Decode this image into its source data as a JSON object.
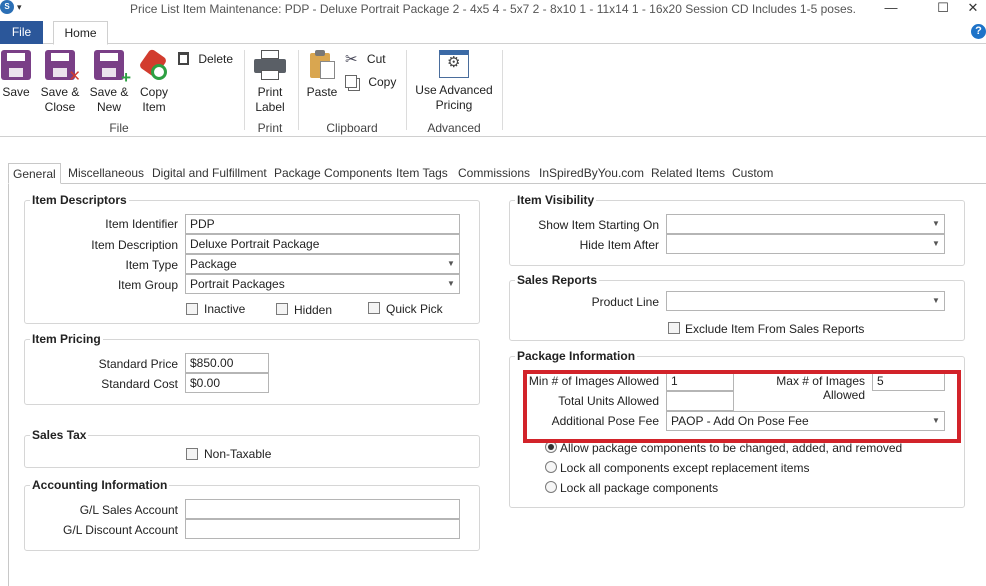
{
  "window": {
    "title": "Price List Item Maintenance: PDP - Deluxe Portrait Package 2 - 4x5 4 - 5x7 2 - 8x10 1 - 11x14 1 - 16x20 Session CD Includes 1-5 poses.",
    "app_icon_text": "S",
    "qa_arrow": "▾",
    "minimize": "—",
    "maximize": "☐",
    "close": "✕"
  },
  "ribbon": {
    "tabs": {
      "file": "File",
      "home": "Home"
    },
    "help": "?",
    "groups": {
      "file": {
        "label": "File",
        "save": "Save",
        "save_close_1": "Save &",
        "save_close_2": "Close",
        "save_new_1": "Save &",
        "save_new_2": "New",
        "copy_1": "Copy",
        "copy_2": "Item",
        "delete": "Delete"
      },
      "print": {
        "label": "Print",
        "print_label_1": "Print",
        "print_label_2": "Label"
      },
      "clipboard": {
        "label": "Clipboard",
        "paste": "Paste",
        "cut": "Cut",
        "copy": "Copy"
      },
      "advanced": {
        "label": "Advanced",
        "use_advanced_1": "Use Advanced",
        "use_advanced_2": "Pricing"
      }
    }
  },
  "tabs": [
    "General",
    "Miscellaneous",
    "Digital and Fulfillment",
    "Package Components",
    "Item Tags",
    "Commissions",
    "InSpiredByYou.com",
    "Related Items",
    "Custom"
  ],
  "item_descriptors": {
    "title": "Item Descriptors",
    "identifier_label": "Item Identifier",
    "identifier_value": "PDP",
    "description_label": "Item Description",
    "description_value": "Deluxe Portrait Package",
    "type_label": "Item Type",
    "type_value": "Package",
    "group_label": "Item Group",
    "group_value": "Portrait Packages",
    "inactive": "Inactive",
    "hidden": "Hidden",
    "quick_pick": "Quick Pick"
  },
  "item_pricing": {
    "title": "Item Pricing",
    "standard_price_label": "Standard Price",
    "standard_price_value": "$850.00",
    "standard_cost_label": "Standard Cost",
    "standard_cost_value": "$0.00"
  },
  "sales_tax": {
    "title": "Sales Tax",
    "non_taxable": "Non-Taxable"
  },
  "accounting": {
    "title": "Accounting Information",
    "gl_sales_label": "G/L Sales Account",
    "gl_sales_value": "",
    "gl_discount_label": "G/L Discount Account",
    "gl_discount_value": ""
  },
  "item_visibility": {
    "title": "Item Visibility",
    "show_label": "Show Item Starting On",
    "show_value": "",
    "hide_label": "Hide Item After",
    "hide_value": ""
  },
  "sales_reports": {
    "title": "Sales Reports",
    "product_line_label": "Product Line",
    "product_line_value": "",
    "exclude": "Exclude Item From Sales Reports"
  },
  "package_info": {
    "title": "Package Information",
    "min_images_label": "Min # of Images Allowed",
    "min_images_value": "1",
    "max_images_label": "Max # of Images Allowed",
    "max_images_value": "5",
    "total_units_label": "Total Units Allowed",
    "total_units_value": "",
    "pose_fee_label": "Additional Pose Fee",
    "pose_fee_value": "PAOP - Add On Pose Fee",
    "option_allow": "Allow package components to be changed, added, and removed",
    "option_lock_except": "Lock all components except replacement items",
    "option_lock_all": "Lock all package components",
    "selected_option": "allow"
  },
  "colors": {
    "ribbon_file": "#2b579a",
    "highlight": "#d2232a",
    "save_icon": "#7a3f87",
    "red_x": "#d23c2e",
    "green_plus": "#2ea043"
  }
}
